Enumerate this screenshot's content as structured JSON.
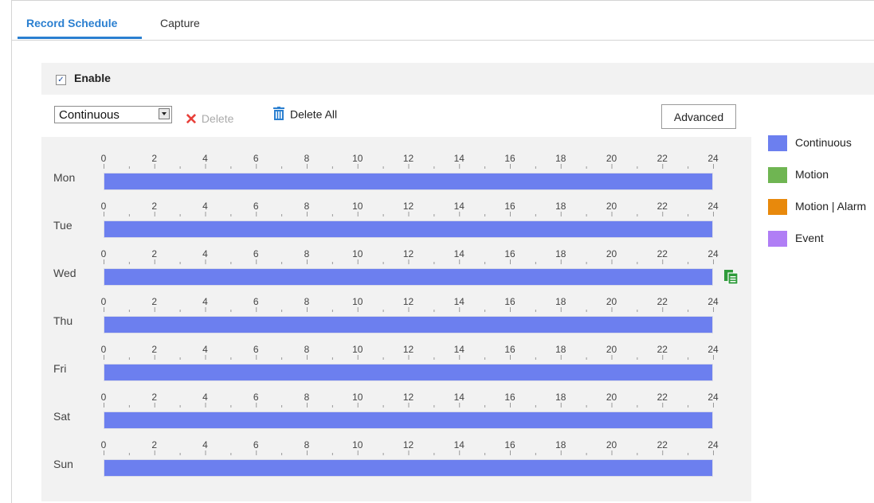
{
  "tabs": [
    {
      "label": "Record Schedule",
      "active": true
    },
    {
      "label": "Capture",
      "active": false
    }
  ],
  "enable": {
    "label": "Enable",
    "checked": true
  },
  "toolbar": {
    "record_type": "Continuous",
    "delete_label": "Delete",
    "delete_all_label": "Delete All",
    "advanced_label": "Advanced"
  },
  "hour_ticks": [
    "0",
    "2",
    "4",
    "6",
    "8",
    "10",
    "12",
    "14",
    "16",
    "18",
    "20",
    "22",
    "24"
  ],
  "days": [
    {
      "label": "Mon",
      "start": 0,
      "end": 24,
      "type": "Continuous"
    },
    {
      "label": "Tue",
      "start": 0,
      "end": 24,
      "type": "Continuous"
    },
    {
      "label": "Wed",
      "start": 0,
      "end": 24,
      "type": "Continuous"
    },
    {
      "label": "Thu",
      "start": 0,
      "end": 24,
      "type": "Continuous"
    },
    {
      "label": "Fri",
      "start": 0,
      "end": 24,
      "type": "Continuous"
    },
    {
      "label": "Sat",
      "start": 0,
      "end": 24,
      "type": "Continuous"
    },
    {
      "label": "Sun",
      "start": 0,
      "end": 24,
      "type": "Continuous"
    }
  ],
  "legend": [
    {
      "label": "Continuous",
      "color": "#6c7fef"
    },
    {
      "label": "Motion",
      "color": "#6fb552"
    },
    {
      "label": "Motion | Alarm",
      "color": "#e8890c"
    },
    {
      "label": "Event",
      "color": "#b07ef5"
    }
  ],
  "colors": {
    "accent": "#2a7fd0",
    "delete_x": "#e8403a",
    "copy_icon": "#2e9a3a"
  }
}
